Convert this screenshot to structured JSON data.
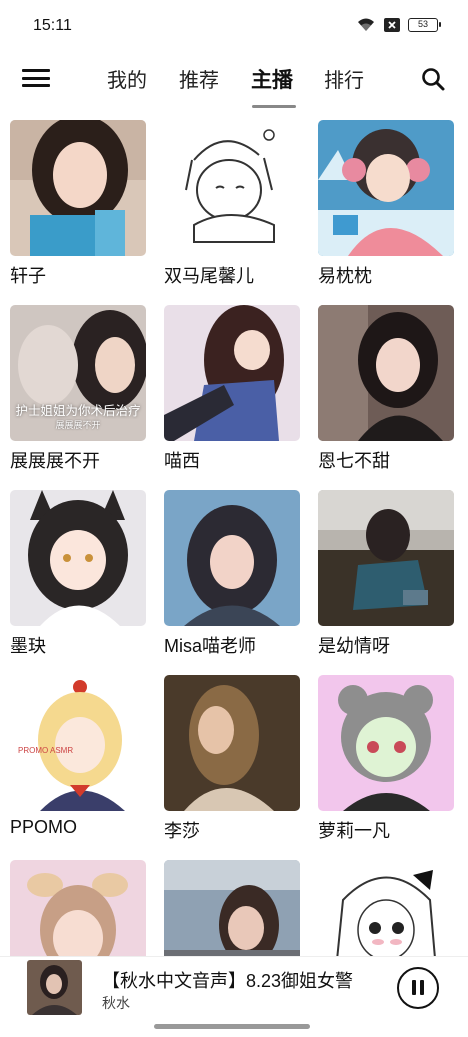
{
  "status_bar": {
    "time": "15:11",
    "battery": "53"
  },
  "nav": {
    "tabs": [
      {
        "label": "我的",
        "active": false
      },
      {
        "label": "推荐",
        "active": false
      },
      {
        "label": "主播",
        "active": true
      },
      {
        "label": "排行",
        "active": false
      }
    ]
  },
  "anchors": [
    {
      "name": "轩子"
    },
    {
      "name": "双马尾馨儿"
    },
    {
      "name": "易枕枕"
    },
    {
      "name": "展展展不开",
      "overlay": "护士姐姐为你术后治疗",
      "overlay_sub": "展展展不开"
    },
    {
      "name": "喵西"
    },
    {
      "name": "恩七不甜"
    },
    {
      "name": "墨玦"
    },
    {
      "name": "Misa喵老师"
    },
    {
      "name": "是幼情呀"
    },
    {
      "name": "PPOMO",
      "overlay": "PROMO ASMR"
    },
    {
      "name": "李莎"
    },
    {
      "name": "萝莉一凡"
    },
    {
      "name": ""
    },
    {
      "name": ""
    },
    {
      "name": ""
    }
  ],
  "player": {
    "title": "【秋水中文音声】8.23御姐女警",
    "artist": "秋水"
  },
  "colors": {
    "accent": "#111111",
    "tab_indicator": "#888888"
  }
}
